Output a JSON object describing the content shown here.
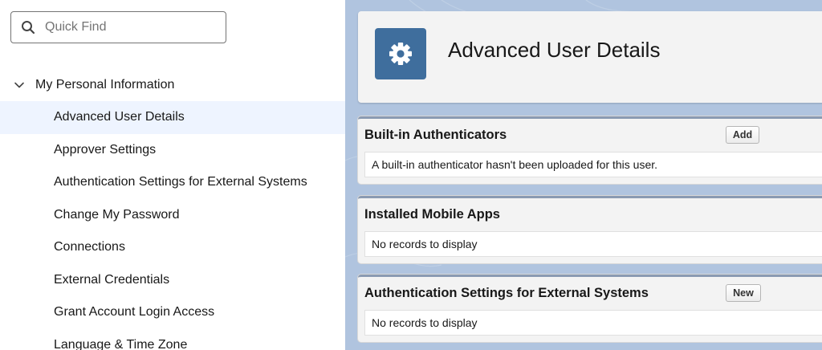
{
  "search": {
    "placeholder": "Quick Find"
  },
  "tree": {
    "header_label": "My Personal Information",
    "items": [
      {
        "label": "Advanced User Details",
        "active": true
      },
      {
        "label": "Approver Settings"
      },
      {
        "label": "Authentication Settings for External Systems"
      },
      {
        "label": "Change My Password"
      },
      {
        "label": "Connections"
      },
      {
        "label": "External Credentials"
      },
      {
        "label": "Grant Account Login Access"
      },
      {
        "label": "Language & Time Zone"
      }
    ]
  },
  "header": {
    "title": "Advanced User Details",
    "icon": "gear-icon",
    "icon_bg": "#3f6e9d"
  },
  "sections": [
    {
      "title": "Built-in Authenticators",
      "button": "Add",
      "message": "A built-in authenticator hasn't been uploaded for this user."
    },
    {
      "title": "Installed Mobile Apps",
      "message": "No records to display"
    },
    {
      "title": "Authentication Settings for External Systems",
      "button": "New",
      "message": "No records to display"
    }
  ],
  "colors": {
    "active_nav_bg": "#eef4ff",
    "main_bg": "#b0c4df",
    "section_border": "#8a9ab2"
  }
}
